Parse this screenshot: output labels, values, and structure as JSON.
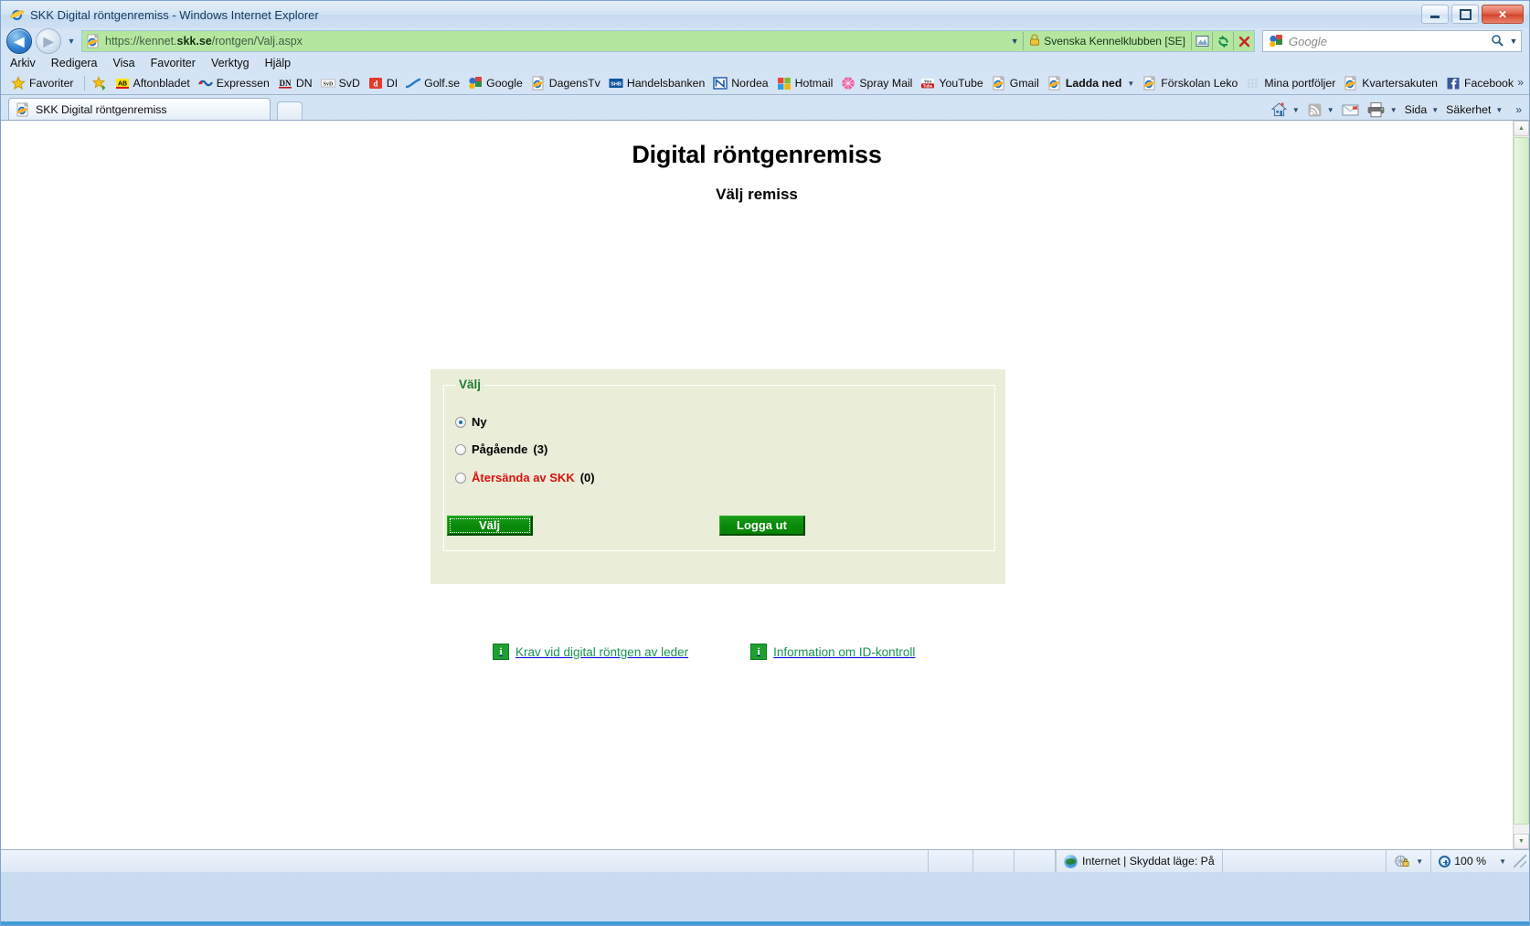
{
  "window": {
    "title": "SKK Digital röntgenremiss - Windows Internet Explorer",
    "minimize_label": "Minimera",
    "maximize_label": "Maximera",
    "close_label": "Stäng"
  },
  "nav": {
    "back_label": "Tillbaka",
    "forward_label": "Framåt",
    "history_label": "Senaste sidor",
    "url_prefix": "https://kennet.",
    "url_domain": "skk.se",
    "url_path": "/rontgen/Valj.aspx",
    "url_full": "https://kennet.skk.se/rontgen/Valj.aspx",
    "cert_label": "Svenska Kennelklubben [SE]",
    "lock_icon": "lock-icon",
    "compat_icon": "compatibility-view-icon",
    "refresh_icon": "refresh-icon",
    "stop_icon": "stop-icon"
  },
  "search": {
    "provider": "Google",
    "placeholder": "Google",
    "go_icon": "magnifier-icon",
    "dropdown_icon": "chevron-down-icon"
  },
  "menubar": {
    "items": [
      {
        "label": "Arkiv",
        "accel": "A"
      },
      {
        "label": "Redigera",
        "accel": "R"
      },
      {
        "label": "Visa",
        "accel": "i"
      },
      {
        "label": "Favoriter",
        "accel": "F"
      },
      {
        "label": "Verktyg",
        "accel": "y"
      },
      {
        "label": "Hjälp",
        "accel": "H"
      }
    ]
  },
  "favorites": {
    "button_label": "Favoriter",
    "button_icon": "star-icon",
    "add_icon": "add-to-favorites-icon",
    "overflow_icon": "chevron-right-icon",
    "items": [
      {
        "label": "Aftonbladet",
        "icon": "aftonbladet-icon",
        "bold": false,
        "dropdown": false
      },
      {
        "label": "Expressen",
        "icon": "expressen-icon",
        "bold": false,
        "dropdown": false
      },
      {
        "label": "DN",
        "icon": "dn-icon",
        "bold": false,
        "dropdown": false
      },
      {
        "label": "SvD",
        "icon": "svd-icon",
        "bold": false,
        "dropdown": false
      },
      {
        "label": "DI",
        "icon": "di-icon",
        "bold": false,
        "dropdown": false
      },
      {
        "label": "Golf.se",
        "icon": "golf-icon",
        "bold": false,
        "dropdown": false
      },
      {
        "label": "Google",
        "icon": "google-icon",
        "bold": false,
        "dropdown": false
      },
      {
        "label": "DagensTv",
        "icon": "ie-page-icon",
        "bold": false,
        "dropdown": false
      },
      {
        "label": "Handelsbanken",
        "icon": "shb-icon",
        "bold": false,
        "dropdown": false
      },
      {
        "label": "Nordea",
        "icon": "nordea-icon",
        "bold": false,
        "dropdown": false
      },
      {
        "label": "Hotmail",
        "icon": "hotmail-icon",
        "bold": false,
        "dropdown": false
      },
      {
        "label": "Spray Mail",
        "icon": "spray-icon",
        "bold": false,
        "dropdown": false
      },
      {
        "label": "YouTube",
        "icon": "youtube-icon",
        "bold": false,
        "dropdown": false
      },
      {
        "label": "Gmail",
        "icon": "ie-page-icon",
        "bold": false,
        "dropdown": false
      },
      {
        "label": "Ladda ned",
        "icon": "ie-page-icon",
        "bold": true,
        "dropdown": true
      },
      {
        "label": "Förskolan Leko",
        "icon": "ie-page-icon",
        "bold": false,
        "dropdown": false
      },
      {
        "label": "Mina portföljer",
        "icon": "grid-icon",
        "bold": false,
        "dropdown": false
      },
      {
        "label": "Kvartersakuten",
        "icon": "ie-page-icon",
        "bold": false,
        "dropdown": false
      },
      {
        "label": "Facebook",
        "icon": "facebook-icon",
        "bold": false,
        "dropdown": false
      }
    ]
  },
  "tabs": {
    "items": [
      {
        "label": "SKK Digital röntgenremiss",
        "icon": "ie-page-icon",
        "active": true
      }
    ],
    "new_tab_label": "Ny flik"
  },
  "commandbar": {
    "home_label": "Startsida",
    "home_icon": "home-icon",
    "feeds_icon": "rss-icon",
    "mail_icon": "mail-icon",
    "print_icon": "printer-icon",
    "page_label": "Sida",
    "safety_label": "Säkerhet",
    "overflow_icon": "chevron-right-icon"
  },
  "page": {
    "heading": "Digital röntgenremiss",
    "subheading": "Välj remiss",
    "panel": {
      "legend": "Välj",
      "options": [
        {
          "label": "Ny",
          "count": "",
          "checked": true,
          "red": false
        },
        {
          "label": "Pågående",
          "count": "(3)",
          "checked": false,
          "red": false
        },
        {
          "label": "Återsända av SKK",
          "count": "(0)",
          "checked": false,
          "red": true
        }
      ],
      "submit_label": "Välj",
      "logout_label": "Logga ut"
    },
    "info_links": [
      {
        "label": "Krav vid digital röntgen av leder",
        "icon": "info-icon"
      },
      {
        "label": "Information om ID-kontroll",
        "icon": "info-icon"
      }
    ]
  },
  "scrollbar": {
    "up_icon": "scroll-up-icon",
    "down_icon": "scroll-down-icon"
  },
  "statusbar": {
    "zone_text": "Internet | Skyddat läge: På",
    "zone_icon": "internet-zone-icon",
    "privacy_icon": "privacy-report-icon",
    "zoom_level": "100 %",
    "zoom_icon": "zoom-icon",
    "dropdown_icon": "chevron-down-icon"
  },
  "colors": {
    "panel_bg": "#eaeed8",
    "legend_green": "#1f7a33",
    "button_green": "#0a8a0a",
    "link_green": "#169650",
    "alert_red": "#d81010",
    "address_bar_green": "#b5e6a0"
  }
}
